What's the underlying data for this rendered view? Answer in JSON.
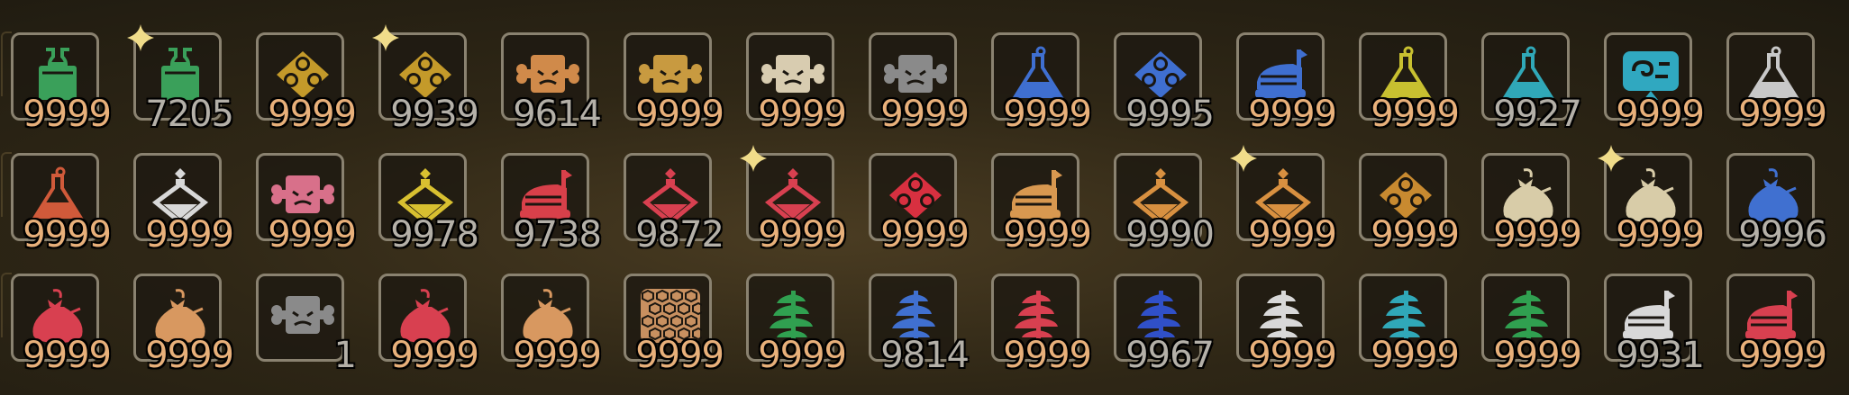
{
  "inventory": {
    "items": [
      {
        "name": "bottle",
        "color": "#3aa05a",
        "count": "9999",
        "full": true
      },
      {
        "name": "bottle",
        "color": "#3aa05a",
        "count": "7205",
        "full": false,
        "new": true
      },
      {
        "name": "blob",
        "color": "#c49a2a",
        "count": "9999",
        "full": true
      },
      {
        "name": "blob",
        "color": "#c49a2a",
        "count": "9939",
        "full": false,
        "new": true
      },
      {
        "name": "bone-cube",
        "color": "#d08a4a",
        "count": "9614",
        "full": false
      },
      {
        "name": "bone-cube",
        "color": "#c89a40",
        "count": "9999",
        "full": true
      },
      {
        "name": "bone-cube",
        "color": "#d8ccb0",
        "count": "9999",
        "full": true
      },
      {
        "name": "bone-cube",
        "color": "#8a8a8a",
        "count": "9999",
        "full": true
      },
      {
        "name": "flask",
        "color": "#3f6fd0",
        "count": "9999",
        "full": true
      },
      {
        "name": "blob",
        "color": "#3f6fd0",
        "count": "9995",
        "full": false
      },
      {
        "name": "whetfish",
        "color": "#3f6fd0",
        "count": "9999",
        "full": true
      },
      {
        "name": "flask",
        "color": "#c8c030",
        "count": "9999",
        "full": true
      },
      {
        "name": "flask",
        "color": "#30a8b8",
        "count": "9927",
        "full": false
      },
      {
        "name": "swirl",
        "color": "#30a8c0",
        "count": "9999",
        "full": true
      },
      {
        "name": "flask",
        "color": "#c8c8c8",
        "count": "9999",
        "full": true
      },
      {
        "name": "flask",
        "color": "#d05a3a",
        "count": "9999",
        "full": true
      },
      {
        "name": "potion",
        "color": "#d8d8d8",
        "count": "9999",
        "full": true
      },
      {
        "name": "bone-cube",
        "color": "#d8708a",
        "count": "9999",
        "full": true
      },
      {
        "name": "potion",
        "color": "#d8c030",
        "count": "9978",
        "full": false
      },
      {
        "name": "whetfish",
        "color": "#d8404a",
        "count": "9738",
        "full": false
      },
      {
        "name": "potion",
        "color": "#d84050",
        "count": "9872",
        "full": false
      },
      {
        "name": "potion",
        "color": "#d84050",
        "count": "9999",
        "full": true,
        "new": true
      },
      {
        "name": "blob",
        "color": "#d83040",
        "count": "9999",
        "full": true
      },
      {
        "name": "whetfish",
        "color": "#d89850",
        "count": "9999",
        "full": true
      },
      {
        "name": "potion",
        "color": "#d89040",
        "count": "9990",
        "full": false
      },
      {
        "name": "potion",
        "color": "#d89040",
        "count": "9999",
        "full": true,
        "new": true
      },
      {
        "name": "blob",
        "color": "#c88a30",
        "count": "9999",
        "full": true
      },
      {
        "name": "sack",
        "color": "#d8cca8",
        "count": "9999",
        "full": true
      },
      {
        "name": "sack",
        "color": "#d8cca8",
        "count": "9999",
        "full": true,
        "new": true
      },
      {
        "name": "sack",
        "color": "#4070d0",
        "count": "9996",
        "full": false
      },
      {
        "name": "sack",
        "color": "#d84050",
        "count": "9999",
        "full": true
      },
      {
        "name": "sack",
        "color": "#d89860",
        "count": "9999",
        "full": true
      },
      {
        "name": "bone-cube",
        "color": "#8a8a8a",
        "count": "1",
        "full": false
      },
      {
        "name": "sack",
        "color": "#d84050",
        "count": "9999",
        "full": true
      },
      {
        "name": "sack",
        "color": "#d89860",
        "count": "9999",
        "full": true
      },
      {
        "name": "honeycomb",
        "color": "#c89060",
        "count": "9999",
        "full": true
      },
      {
        "name": "herb",
        "color": "#30a050",
        "count": "9999",
        "full": true
      },
      {
        "name": "herb",
        "color": "#4070d0",
        "count": "9814",
        "full": false
      },
      {
        "name": "herb",
        "color": "#d84050",
        "count": "9999",
        "full": true
      },
      {
        "name": "herb",
        "color": "#3050c8",
        "count": "9967",
        "full": false
      },
      {
        "name": "herb",
        "color": "#d8d8d8",
        "count": "9999",
        "full": true
      },
      {
        "name": "herb",
        "color": "#30a8b8",
        "count": "9999",
        "full": true
      },
      {
        "name": "herb",
        "color": "#30a050",
        "count": "9999",
        "full": true
      },
      {
        "name": "whetfish",
        "color": "#d8d8d8",
        "count": "9931",
        "full": false
      },
      {
        "name": "whetfish",
        "color": "#d84050",
        "count": "9999",
        "full": true
      }
    ]
  }
}
